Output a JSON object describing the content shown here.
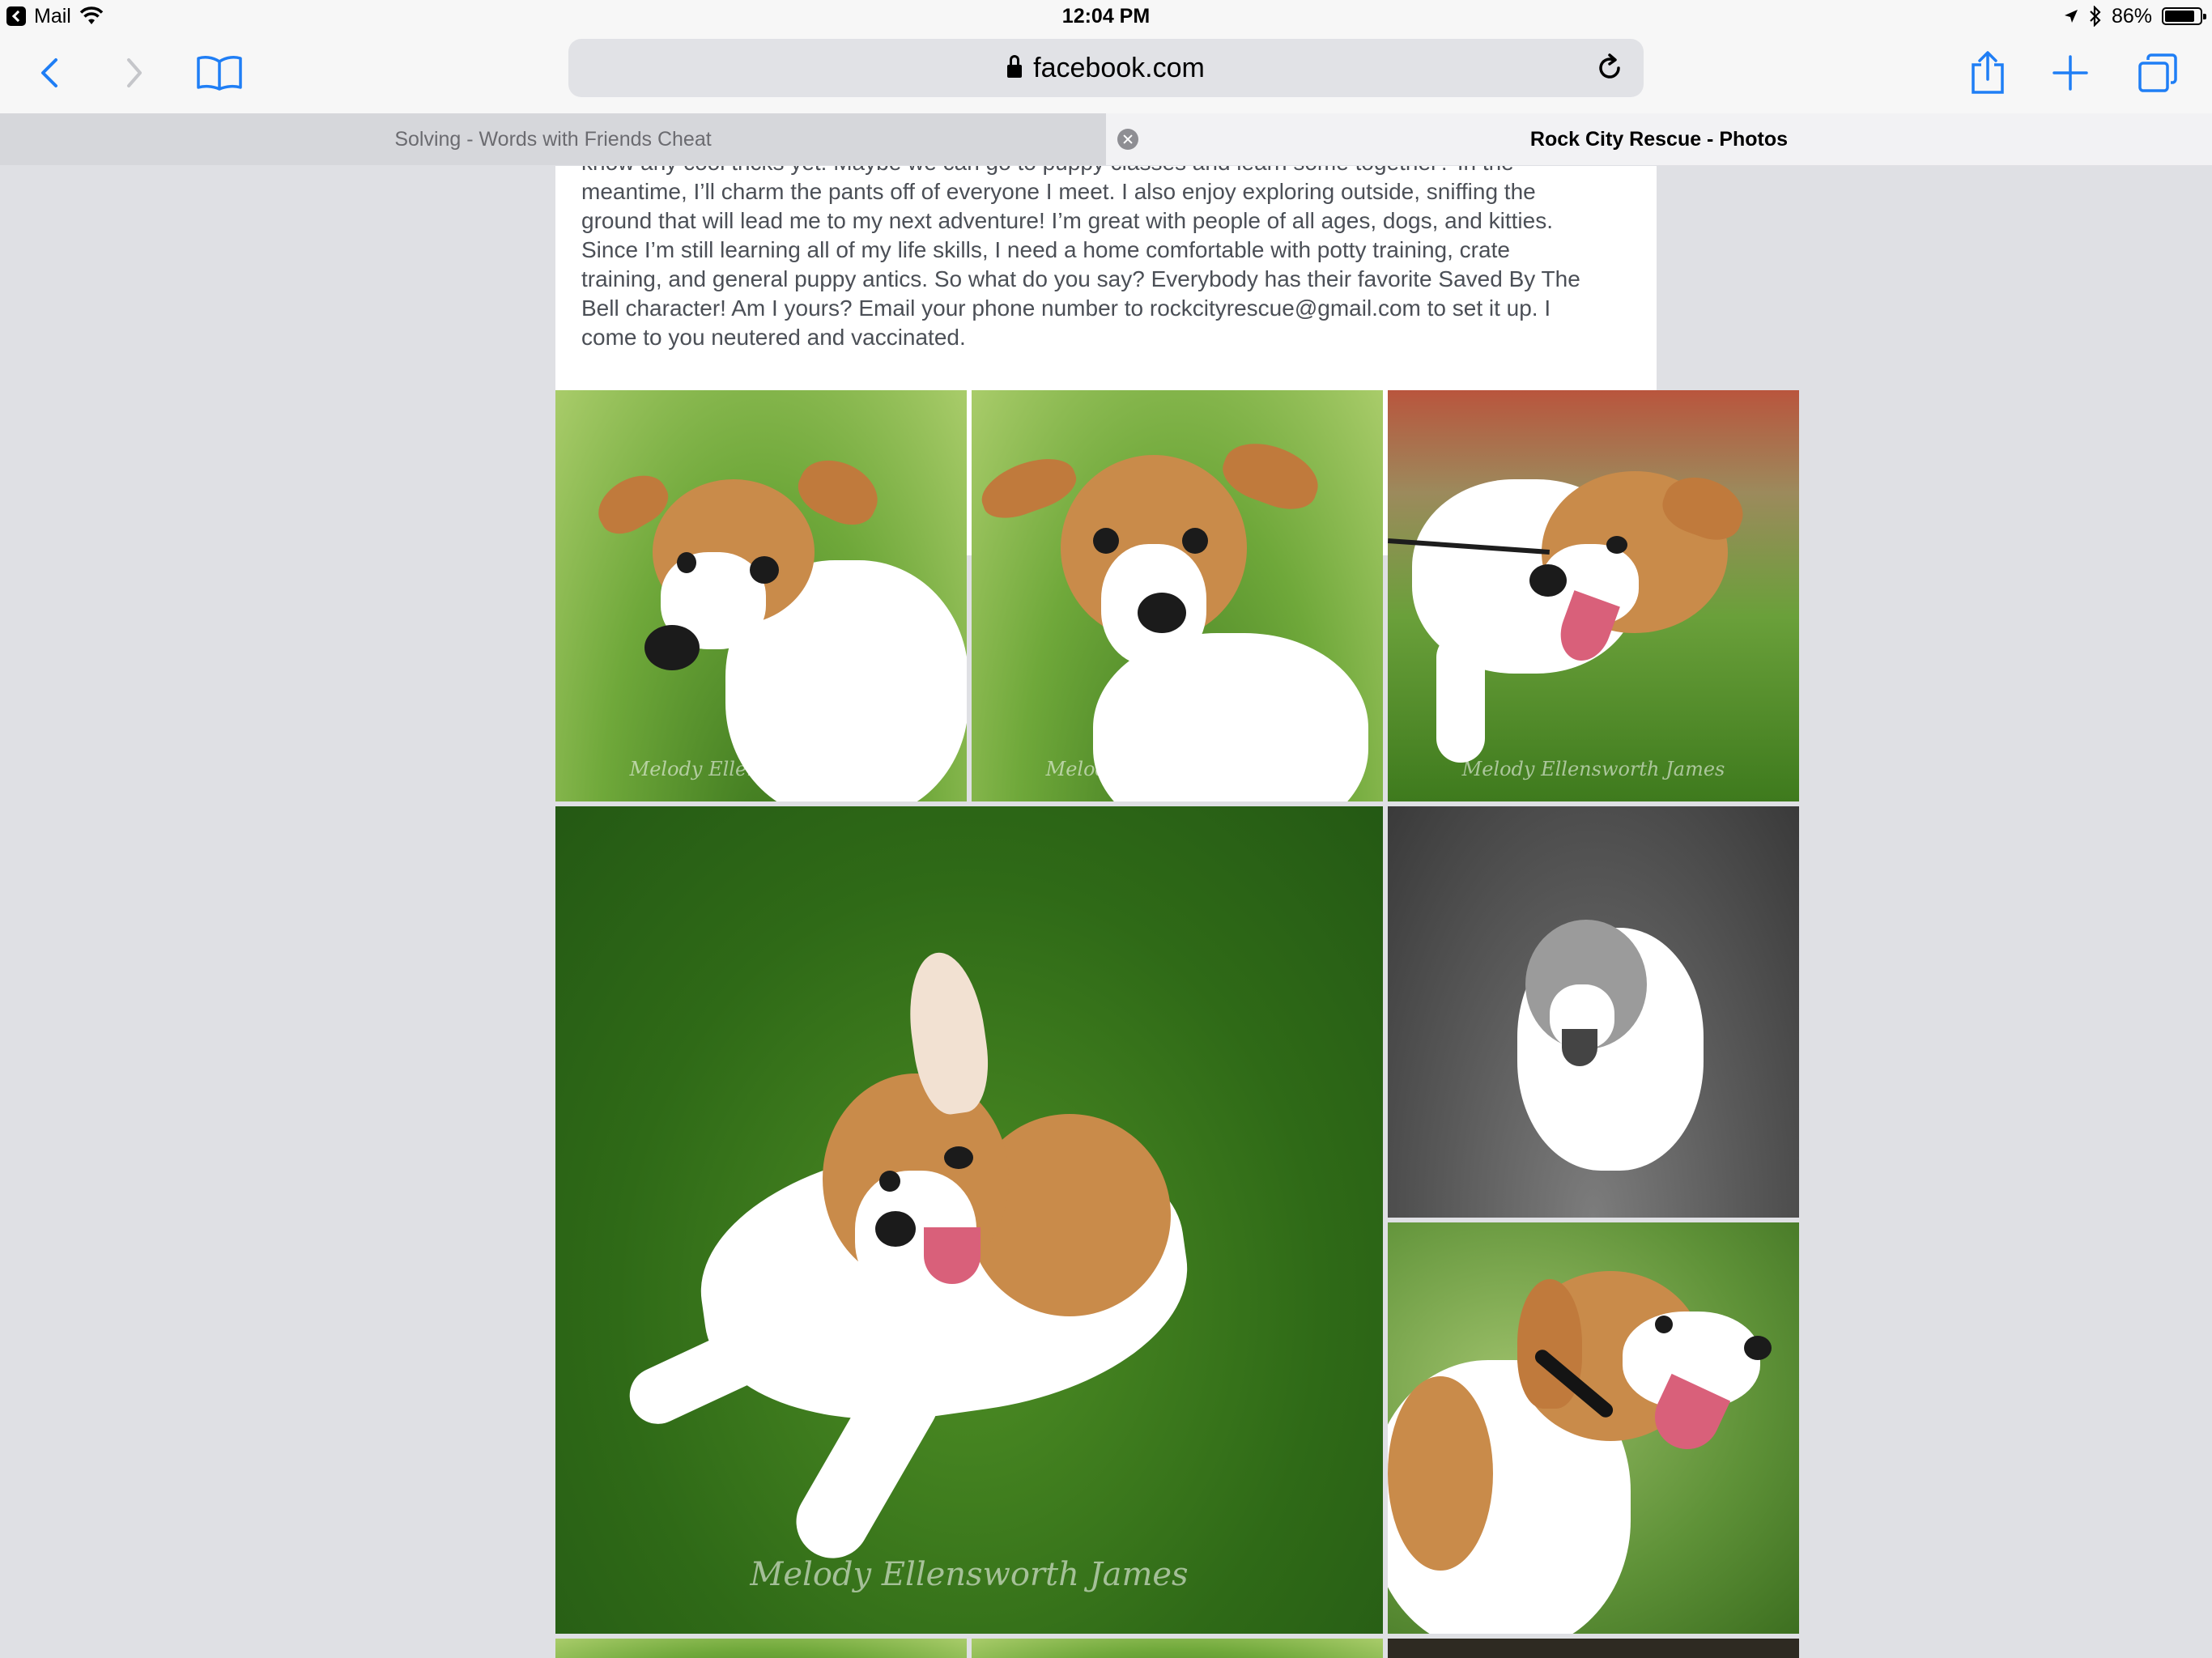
{
  "status_bar": {
    "back_app": "Mail",
    "time": "12:04 PM",
    "battery": "86%",
    "battery_level": 0.86
  },
  "browser": {
    "url": "facebook.com",
    "tabs": [
      {
        "label": "Solving - Words with Friends Cheat"
      },
      {
        "label": "Rock City Rescue - Photos"
      }
    ]
  },
  "post": {
    "lines": [
      "know any cool tricks yet! Maybe we can go to puppy classes and learn some together? In the",
      "meantime, I’ll charm the pants off of everyone I meet. I also enjoy exploring outside, sniffing the",
      "ground that will lead me to my next adventure! I’m great with people of all ages, dogs, and kitties.",
      "Since I’m still learning all of my life skills, I need a home comfortable with potty training, crate",
      "training, and general puppy antics. So what do you say? Everybody has their favorite Saved By The",
      "Bell character! Am I yours? Email your phone number to rockcityrescue@gmail.com to set it up. I",
      "come to you neutered and vaccinated."
    ]
  },
  "photos": [
    {
      "watermark": "Melody Ellensworth James"
    },
    {
      "watermark": "Melody Ellensworth James"
    },
    {
      "watermark": "Melody Ellensworth James"
    },
    {
      "watermark": "Melody Ellensworth James"
    }
  ],
  "colors": {
    "accent": "#1f7ef5",
    "page_bg": "#dfe0e4"
  },
  "icons": {
    "back": "chevron-left-icon",
    "forward": "chevron-right-icon",
    "bookmarks": "book-icon",
    "reload": "reload-icon",
    "share": "share-icon",
    "new_tab": "plus-icon",
    "tabs": "tabs-icon"
  }
}
